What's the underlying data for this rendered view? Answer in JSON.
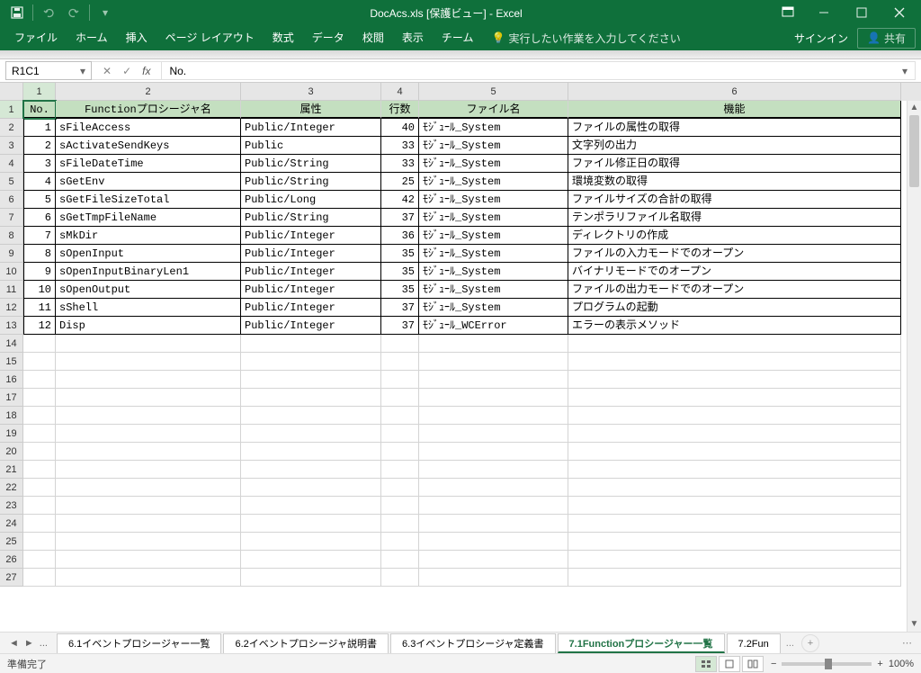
{
  "title": "DocAcs.xls [保護ビュー] - Excel",
  "ribbon": {
    "tabs": [
      "ファイル",
      "ホーム",
      "挿入",
      "ページ レイアウト",
      "数式",
      "データ",
      "校閲",
      "表示",
      "チーム"
    ],
    "tell_me": "実行したい作業を入力してください",
    "signin": "サインイン",
    "share": "共有"
  },
  "namebox": "R1C1",
  "formula": "No.",
  "col_headers": [
    "1",
    "2",
    "3",
    "4",
    "5",
    "6"
  ],
  "headers": {
    "c1": "No.",
    "c2": "Functionプロシージャ名",
    "c3": "属性",
    "c4": "行数",
    "c5": "ファイル名",
    "c6": "機能"
  },
  "rows": [
    {
      "n": "1",
      "name": "sFileAccess",
      "attr": "Public/Integer",
      "lines": "40",
      "file": "ﾓｼﾞｭｰﾙ_System",
      "func": "ファイルの属性の取得"
    },
    {
      "n": "2",
      "name": "sActivateSendKeys",
      "attr": "Public",
      "lines": "33",
      "file": "ﾓｼﾞｭｰﾙ_System",
      "func": "文字列の出力"
    },
    {
      "n": "3",
      "name": "sFileDateTime",
      "attr": "Public/String",
      "lines": "33",
      "file": "ﾓｼﾞｭｰﾙ_System",
      "func": "ファイル修正日の取得"
    },
    {
      "n": "4",
      "name": "sGetEnv",
      "attr": "Public/String",
      "lines": "25",
      "file": "ﾓｼﾞｭｰﾙ_System",
      "func": "環境変数の取得"
    },
    {
      "n": "5",
      "name": "sGetFileSizeTotal",
      "attr": "Public/Long",
      "lines": "42",
      "file": "ﾓｼﾞｭｰﾙ_System",
      "func": "ファイルサイズの合計の取得"
    },
    {
      "n": "6",
      "name": "sGetTmpFileName",
      "attr": "Public/String",
      "lines": "37",
      "file": "ﾓｼﾞｭｰﾙ_System",
      "func": "テンポラリファイル名取得"
    },
    {
      "n": "7",
      "name": "sMkDir",
      "attr": "Public/Integer",
      "lines": "36",
      "file": "ﾓｼﾞｭｰﾙ_System",
      "func": "ディレクトリの作成"
    },
    {
      "n": "8",
      "name": "sOpenInput",
      "attr": "Public/Integer",
      "lines": "35",
      "file": "ﾓｼﾞｭｰﾙ_System",
      "func": "ファイルの入力モードでのオープン"
    },
    {
      "n": "9",
      "name": "sOpenInputBinaryLen1",
      "attr": "Public/Integer",
      "lines": "35",
      "file": "ﾓｼﾞｭｰﾙ_System",
      "func": "バイナリモードでのオープン"
    },
    {
      "n": "10",
      "name": "sOpenOutput",
      "attr": "Public/Integer",
      "lines": "35",
      "file": "ﾓｼﾞｭｰﾙ_System",
      "func": "ファイルの出力モードでのオープン"
    },
    {
      "n": "11",
      "name": "sShell",
      "attr": "Public/Integer",
      "lines": "37",
      "file": "ﾓｼﾞｭｰﾙ_System",
      "func": "プログラムの起動"
    },
    {
      "n": "12",
      "name": "Disp",
      "attr": "Public/Integer",
      "lines": "37",
      "file": "ﾓｼﾞｭｰﾙ_WCError",
      "func": "エラーの表示メソッド"
    }
  ],
  "empty_row_count": 14,
  "sheet_tabs": {
    "ellipsis": "...",
    "items": [
      "6.1イベントプロシージャー一覧",
      "6.2イベントプロシージャ説明書",
      "6.3イベントプロシージャ定義書",
      "7.1Functionプロシージャー一覧",
      "7.2Fun"
    ],
    "active_index": 3,
    "truncated_suffix": "..."
  },
  "status": {
    "left": "準備完了",
    "zoom": "100%"
  }
}
